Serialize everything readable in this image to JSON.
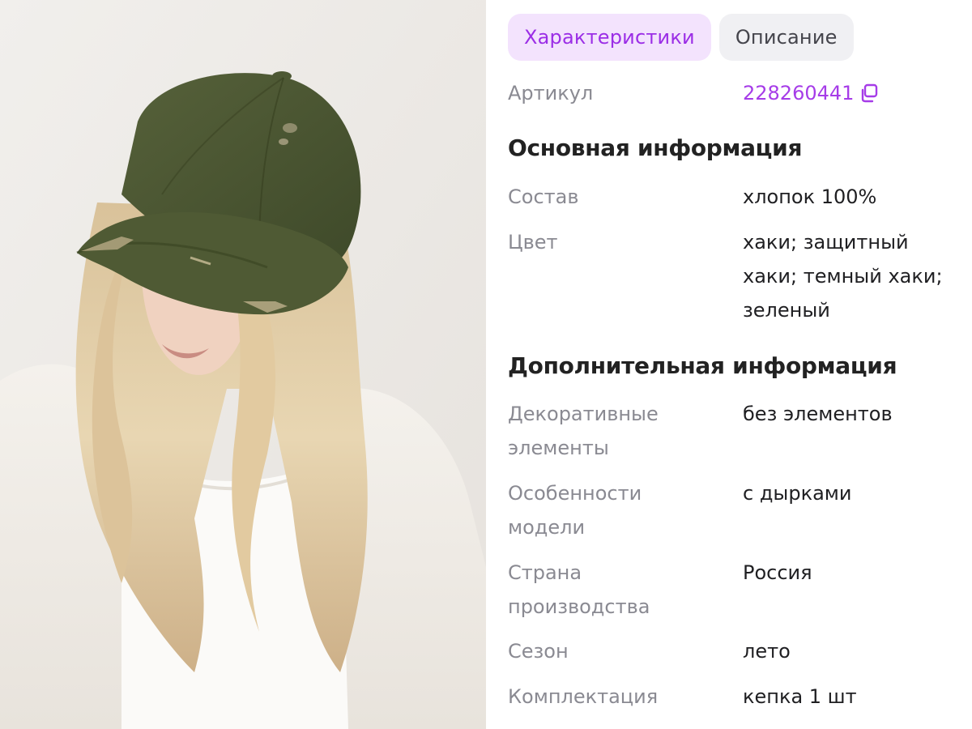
{
  "tabs": [
    {
      "label": "Характеристики",
      "active": true
    },
    {
      "label": "Описание",
      "active": false
    }
  ],
  "article": {
    "label": "Артикул",
    "value": "228260441",
    "icon": "copy-icon"
  },
  "sections": [
    {
      "title": "Основная информация",
      "rows": [
        {
          "label": "Состав",
          "value": "хлопок 100%"
        },
        {
          "label": "Цвет",
          "value_lines": [
            "хаки; защитный",
            "хаки; темный хаки;",
            "зеленый"
          ]
        }
      ]
    },
    {
      "title": "Дополнительная информация",
      "rows": [
        {
          "label_lines": [
            "Декоративные",
            "элементы"
          ],
          "value": "без элементов"
        },
        {
          "label_lines": [
            "Особенности",
            "модели"
          ],
          "value": "с дырками"
        },
        {
          "label_lines": [
            "Страна",
            "производства"
          ],
          "value": "Россия"
        },
        {
          "label": "Сезон",
          "value": "лето"
        },
        {
          "label": "Комплектация",
          "value": "кепка 1 шт"
        }
      ]
    }
  ],
  "colors": {
    "accent": "#9b2ee6",
    "accent_bg": "#f3e3fd",
    "muted": "#8a8a92",
    "cap": "#4b5631"
  }
}
